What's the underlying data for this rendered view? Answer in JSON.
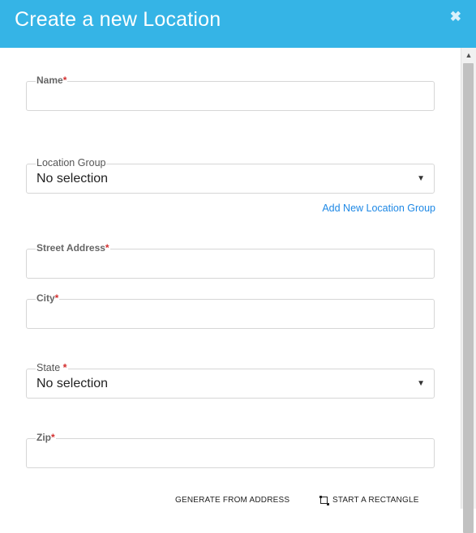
{
  "dialog": {
    "title": "Create a new Location",
    "close_label": "✖"
  },
  "form": {
    "name": {
      "label": "Name",
      "required_mark": "*",
      "value": ""
    },
    "location_group": {
      "label": "Location Group",
      "selected": "No selection"
    },
    "add_group_link": "Add New Location Group",
    "street_address": {
      "label": "Street Address",
      "required_mark": "*",
      "value": ""
    },
    "city": {
      "label": "City",
      "required_mark": "*",
      "value": ""
    },
    "state": {
      "label": "State ",
      "required_mark": "*",
      "selected": "No selection"
    },
    "zip": {
      "label": "Zip",
      "required_mark": "*",
      "value": ""
    }
  },
  "footer": {
    "generate_label": "GENERATE FROM ADDRESS",
    "rectangle_label": "START A RECTANGLE"
  },
  "colors": {
    "header": "#35b4e6",
    "link": "#1e88e5",
    "required": "#d32f2f"
  }
}
